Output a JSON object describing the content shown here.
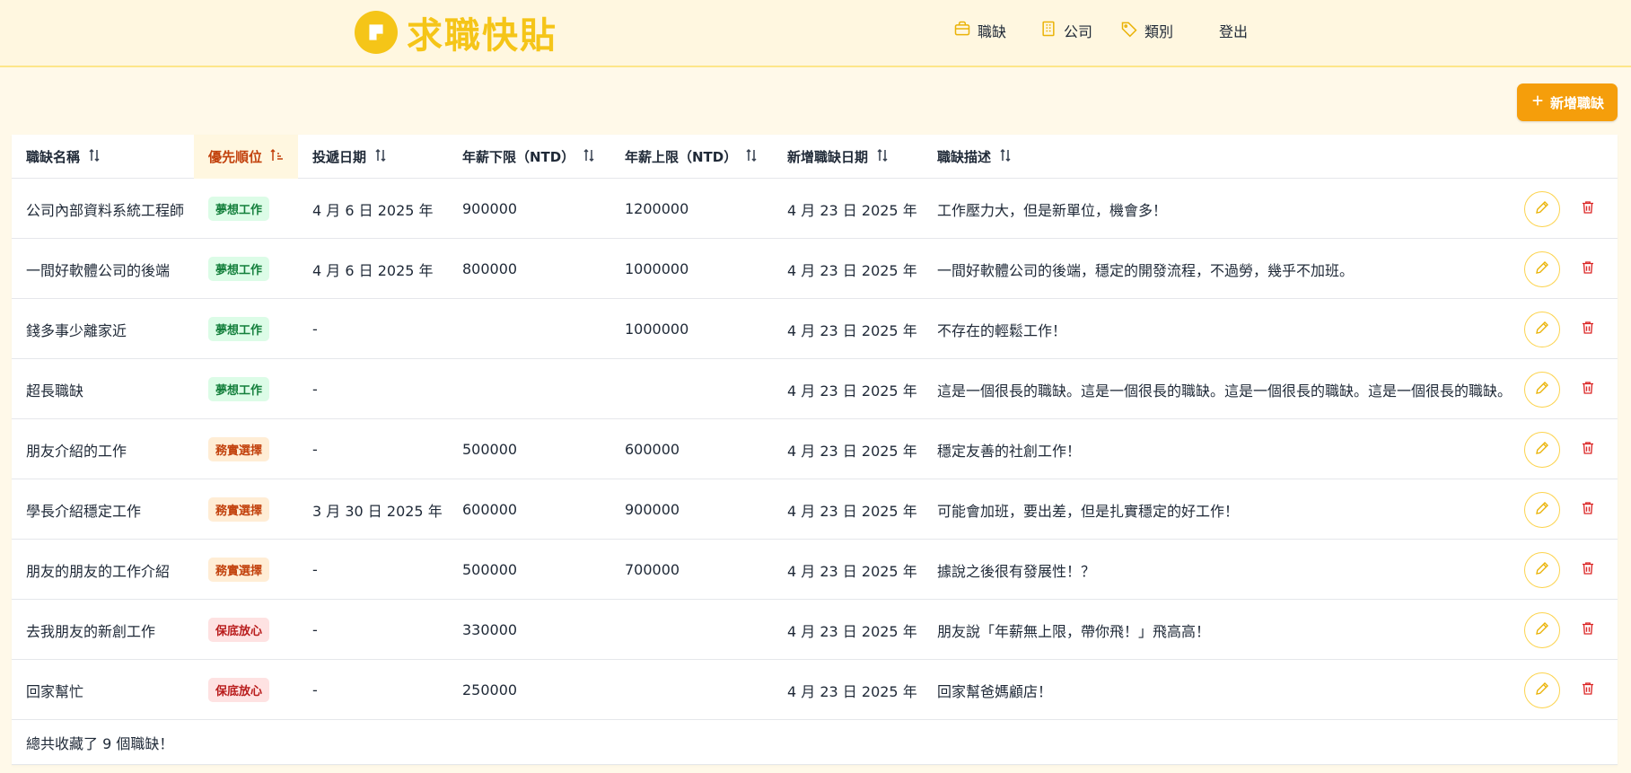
{
  "app": {
    "title": "求職快貼"
  },
  "nav": [
    {
      "icon": "briefcase-icon",
      "label": "職缺"
    },
    {
      "icon": "building-icon",
      "label": "公司"
    },
    {
      "icon": "tag-icon",
      "label": "類別"
    },
    {
      "label": "登出"
    }
  ],
  "add_button": {
    "label": "新增職缺",
    "icon": "plus-icon"
  },
  "columns": [
    {
      "label": "職缺名稱",
      "sort": "none"
    },
    {
      "label": "優先順位",
      "sort": "ascending"
    },
    {
      "label": "投遞日期",
      "sort": "none"
    },
    {
      "label": "年薪下限（NTD）",
      "sort": "none"
    },
    {
      "label": "年薪上限（NTD）",
      "sort": "none"
    },
    {
      "label": "新增職缺日期",
      "sort": "none"
    },
    {
      "label": "職缺描述",
      "sort": "none"
    }
  ],
  "rows": [
    {
      "name": "公司內部資料系統工程師",
      "priority": "夢想工作",
      "priority_type": "dream",
      "applied": "4 月 6 日 2025 年",
      "salary_min": "900000",
      "salary_max": "1200000",
      "created": "4 月 23 日 2025 年",
      "description": "工作壓力大，但是新單位，機會多！"
    },
    {
      "name": "一間好軟體公司的後端",
      "priority": "夢想工作",
      "priority_type": "dream",
      "applied": "4 月 6 日 2025 年",
      "salary_min": "800000",
      "salary_max": "1000000",
      "created": "4 月 23 日 2025 年",
      "description": "一間好軟體公司的後端，穩定的開發流程，不過勞，幾乎不加班。"
    },
    {
      "name": "錢多事少離家近",
      "priority": "夢想工作",
      "priority_type": "dream",
      "applied": "-",
      "salary_min": "",
      "salary_max": "1000000",
      "created": "4 月 23 日 2025 年",
      "description": "不存在的輕鬆工作！"
    },
    {
      "name": "超長職缺",
      "priority": "夢想工作",
      "priority_type": "dream",
      "applied": "-",
      "salary_min": "",
      "salary_max": "",
      "created": "4 月 23 日 2025 年",
      "description": "這是一個很長的職缺。這是一個很長的職缺。這是一個很長的職缺。這是一個很長的職缺。"
    },
    {
      "name": "朋友介紹的工作",
      "priority": "務實選擇",
      "priority_type": "practical",
      "applied": "-",
      "salary_min": "500000",
      "salary_max": "600000",
      "created": "4 月 23 日 2025 年",
      "description": "穩定友善的社創工作！"
    },
    {
      "name": "學長介紹穩定工作",
      "priority": "務實選擇",
      "priority_type": "practical",
      "applied": "3 月 30 日 2025 年",
      "salary_min": "600000",
      "salary_max": "900000",
      "created": "4 月 23 日 2025 年",
      "description": "可能會加班，要出差，但是扎實穩定的好工作！"
    },
    {
      "name": "朋友的朋友的工作介紹",
      "priority": "務實選擇",
      "priority_type": "practical",
      "applied": "-",
      "salary_min": "500000",
      "salary_max": "700000",
      "created": "4 月 23 日 2025 年",
      "description": "據說之後很有發展性！？"
    },
    {
      "name": "去我朋友的新創工作",
      "priority": "保底放心",
      "priority_type": "safe",
      "applied": "-",
      "salary_min": "330000",
      "salary_max": "",
      "created": "4 月 23 日 2025 年",
      "description": "朋友說「年薪無上限，帶你飛！」飛高高！"
    },
    {
      "name": "回家幫忙",
      "priority": "保底放心",
      "priority_type": "safe",
      "applied": "-",
      "salary_min": "250000",
      "salary_max": "",
      "created": "4 月 23 日 2025 年",
      "description": "回家幫爸媽顧店！"
    }
  ],
  "footer": {
    "summary": "總共收藏了 9 個職缺！"
  },
  "colors": {
    "brand": "#f5c518",
    "accent_button": "#f59e0b",
    "dream_badge": "#15803d",
    "practical_badge": "#c2410c",
    "safe_badge": "#b91c1c",
    "delete_icon": "#dc2626"
  }
}
